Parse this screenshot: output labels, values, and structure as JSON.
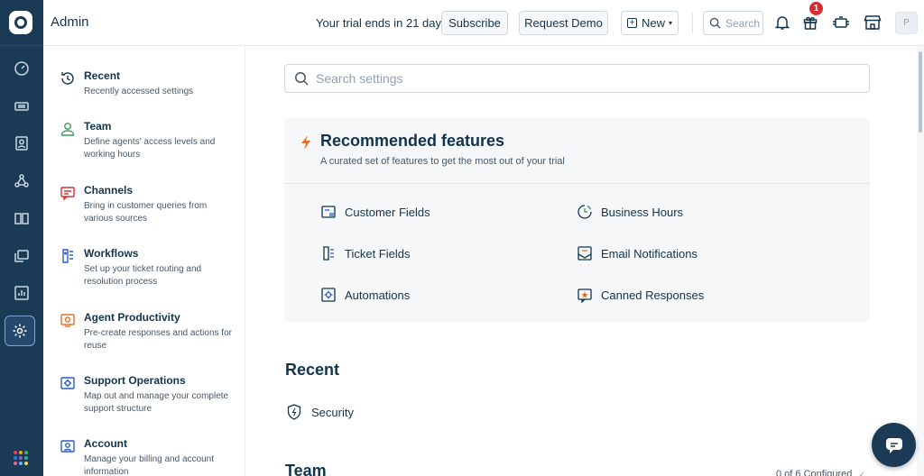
{
  "app": {
    "title": "Admin"
  },
  "topbar": {
    "trial_text": "Your trial ends in 21 days",
    "subscribe_label": "Subscribe",
    "request_demo_label": "Request Demo",
    "new_label": "New",
    "search_placeholder": "Search",
    "gift_badge_count": "1",
    "avatar_initial": "P"
  },
  "rail": {
    "items": [
      "dashboard-icon",
      "tickets-icon",
      "contacts-icon",
      "social-icon",
      "solutions-icon",
      "discussions-icon",
      "reports-icon",
      "admin-settings-icon"
    ],
    "active": "admin-settings-icon",
    "apps_dot_colors": [
      "#e6484c",
      "#f6a609",
      "#3cb371",
      "#2c7be5",
      "#9b59b6",
      "#1abc9c",
      "#f06292",
      "#4fc3f7",
      "#ffd54f"
    ]
  },
  "settings_nav": {
    "items": [
      {
        "title": "Recent",
        "desc": "Recently accessed settings",
        "icon": "history-icon"
      },
      {
        "title": "Team",
        "desc": "Define agents' access levels and working hours",
        "icon": "user-icon"
      },
      {
        "title": "Channels",
        "desc": "Bring in customer queries from various sources",
        "icon": "chat-icon"
      },
      {
        "title": "Workflows",
        "desc": "Set up your ticket routing and resolution process",
        "icon": "workflow-icon"
      },
      {
        "title": "Agent Productivity",
        "desc": "Pre-create responses and actions for reuse",
        "icon": "productivity-icon"
      },
      {
        "title": "Support Operations",
        "desc": "Map out and manage your complete support structure",
        "icon": "support-ops-icon"
      },
      {
        "title": "Account",
        "desc": "Manage your billing and account information",
        "icon": "account-icon"
      }
    ]
  },
  "main": {
    "search_placeholder": "Search settings",
    "recommended": {
      "title": "Recommended features",
      "subtitle": "A curated set of features to get the most out of your trial",
      "features": [
        {
          "label": "Customer Fields",
          "icon": "customer-fields-icon"
        },
        {
          "label": "Business Hours",
          "icon": "business-hours-icon"
        },
        {
          "label": "Ticket Fields",
          "icon": "ticket-fields-icon"
        },
        {
          "label": "Email Notifications",
          "icon": "email-notifications-icon"
        },
        {
          "label": "Automations",
          "icon": "automations-icon"
        },
        {
          "label": "Canned Responses",
          "icon": "canned-responses-icon"
        }
      ]
    },
    "recent_section": {
      "title": "Recent",
      "items": [
        {
          "label": "Security",
          "icon": "shield-icon"
        }
      ]
    },
    "team_section": {
      "title": "Team",
      "configured": "0 of 6 Configured"
    }
  },
  "colors": {
    "rail_bg": "#1b3a55",
    "accent_orange": "#e86f25",
    "text_primary": "#12344d",
    "card_bg": "#f5f7f9",
    "icon_blue": "#2c5cc5"
  }
}
